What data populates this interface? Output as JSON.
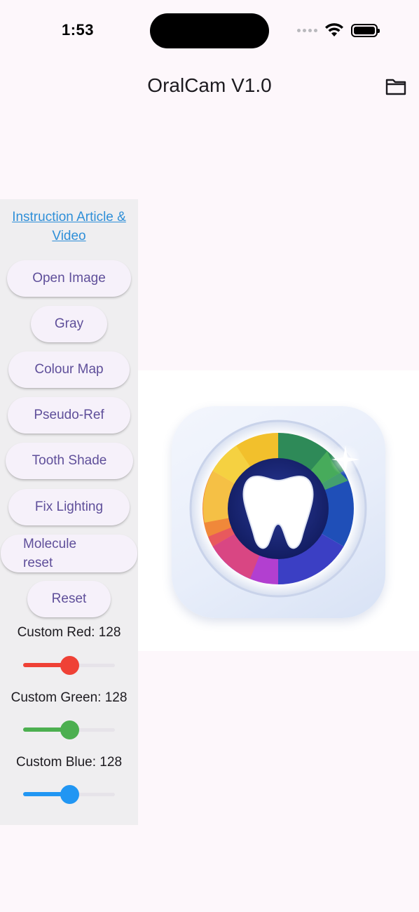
{
  "status_bar": {
    "time": "1:53"
  },
  "app_bar": {
    "title": "OralCam V1.0",
    "folder_icon": "folder-icon"
  },
  "panel": {
    "link_text": "Instruction Article &\nVideo",
    "buttons": {
      "open_image": "Open Image",
      "gray": "Gray",
      "colour_map": "Colour Map",
      "pseudo_ref": "Pseudo-Ref",
      "tooth_shade": "Tooth Shade",
      "fix_lighting": "Fix Lighting",
      "molecule_reset": "Molecule\nreset",
      "reset": "Reset"
    },
    "sliders": {
      "red": {
        "label": "Custom Red: 128",
        "value": 128,
        "min": 0,
        "max": 255,
        "color": "#ef4136"
      },
      "green": {
        "label": "Custom Green: 128",
        "value": 128,
        "min": 0,
        "max": 255,
        "color": "#4caf50"
      },
      "blue": {
        "label": "Custom Blue: 128",
        "value": 128,
        "min": 0,
        "max": 255,
        "color": "#2196f3"
      }
    }
  },
  "image": {
    "description_icon": "tooth-camera-logo-icon"
  }
}
